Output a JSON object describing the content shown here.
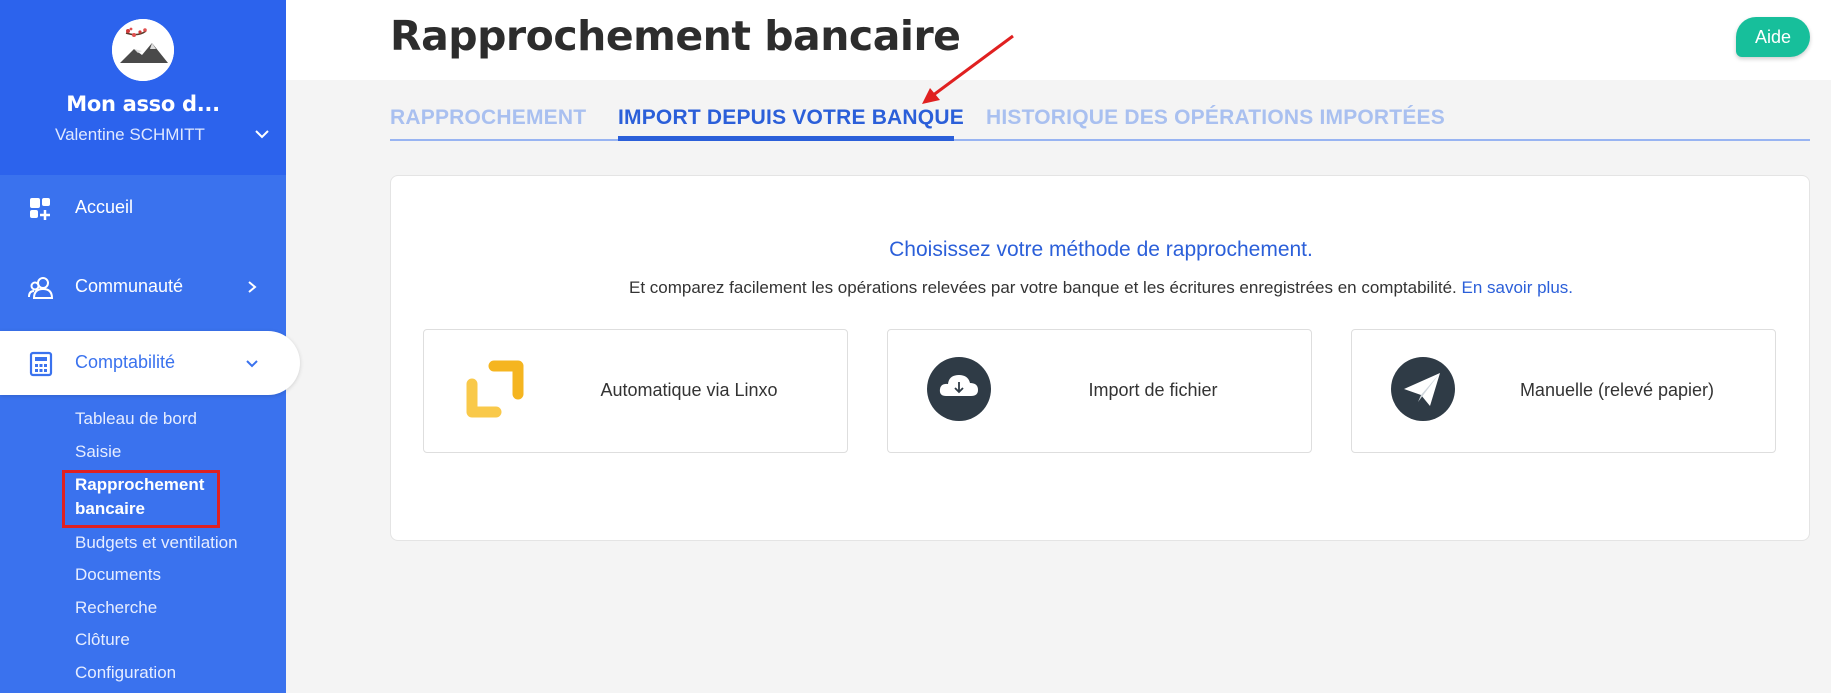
{
  "sidebar": {
    "org_name": "Mon asso d...",
    "user_name": "Valentine SCHMITT",
    "nav": {
      "home": "Accueil",
      "community": "Communauté",
      "accounting": "Comptabilité"
    },
    "subnav": [
      "Tableau de bord",
      "Saisie",
      "Rapprochement",
      "bancaire",
      "Budgets et ventilation",
      "Documents",
      "Recherche",
      "Clôture",
      "Configuration"
    ]
  },
  "header": {
    "title": "Rapprochement bancaire",
    "help_label": "Aide"
  },
  "tabs": [
    {
      "label": "RAPPROCHEMENT",
      "active": false
    },
    {
      "label": "IMPORT DEPUIS VOTRE BANQUE",
      "active": true
    },
    {
      "label": "HISTORIQUE DES OPÉRATIONS IMPORTÉES",
      "active": false
    }
  ],
  "card": {
    "title": "Choisissez votre méthode de rapprochement.",
    "subtitle": "Et comparez facilement les opérations relevées par votre banque et les écritures enregistrées en comptabilité.",
    "learn_more": "En savoir plus.",
    "methods": [
      {
        "label": "Automatique via Linxo",
        "icon": "linxo-icon"
      },
      {
        "label": "Import de fichier",
        "icon": "cloud-download-icon"
      },
      {
        "label": "Manuelle (relevé papier)",
        "icon": "paper-plane-icon"
      }
    ]
  },
  "colors": {
    "primary": "#2b5fd9",
    "sidebar": "#3a72ee",
    "help": "#17bf9b",
    "annotation": "#e02020"
  }
}
